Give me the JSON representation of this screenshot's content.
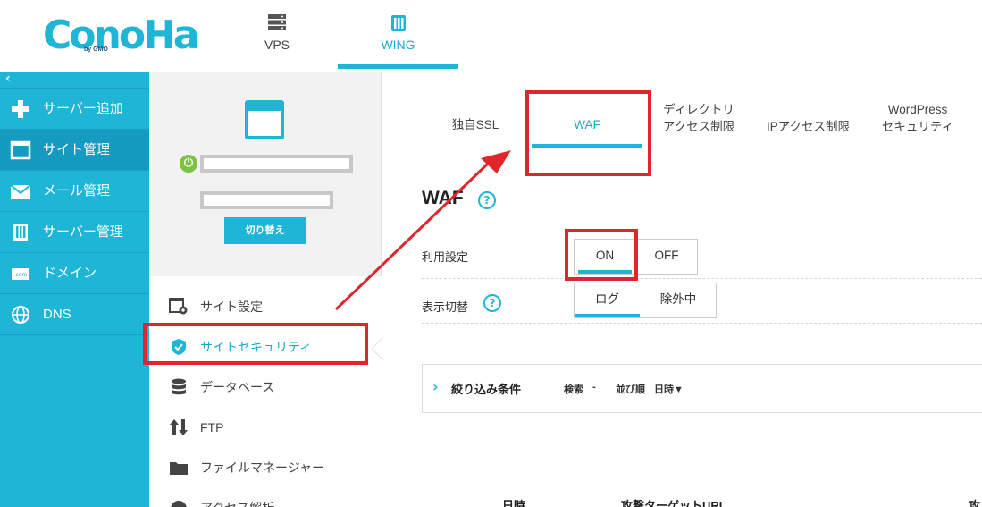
{
  "header": {
    "logo_text": "ConoHa",
    "logo_sub": "by GMO",
    "tabs": [
      {
        "label": "VPS",
        "icon": "server-stack-icon"
      },
      {
        "label": "WING",
        "icon": "wing-server-icon"
      }
    ]
  },
  "sidebar": {
    "collapse_label": "‹",
    "items": [
      {
        "label": "サーバー追加",
        "icon": "plus-icon"
      },
      {
        "label": "サイト管理",
        "icon": "window-icon"
      },
      {
        "label": "メール管理",
        "icon": "mail-icon"
      },
      {
        "label": "サーバー管理",
        "icon": "server-icon"
      },
      {
        "label": "ドメイン",
        "icon": "domain-icon"
      },
      {
        "label": "DNS",
        "icon": "globe-icon"
      }
    ]
  },
  "server_card": {
    "switch_label": "切り替え"
  },
  "site_menu": {
    "items": [
      {
        "label": "サイト設定",
        "icon": "site-settings-icon"
      },
      {
        "label": "サイトセキュリティ",
        "icon": "shield-check-icon"
      },
      {
        "label": "データベース",
        "icon": "database-icon"
      },
      {
        "label": "FTP",
        "icon": "transfer-arrows-icon"
      },
      {
        "label": "ファイルマネージャー",
        "icon": "folder-icon"
      },
      {
        "label": "アクセス解析",
        "icon": "pie-chart-icon"
      }
    ]
  },
  "security_tabs": {
    "ssl": "独自SSL",
    "waf": "WAF",
    "dir_line1": "ディレクトリ",
    "dir_line2": "アクセス制限",
    "ip": "IPアクセス制限",
    "wp_line1": "WordPress",
    "wp_line2": "セキュリティ"
  },
  "waf": {
    "title": "WAF",
    "help": "?",
    "usage_label": "利用設定",
    "on": "ON",
    "off": "OFF",
    "display_label": "表示切替",
    "log": "ログ",
    "excluded": "除外中"
  },
  "filter": {
    "chevron": "›",
    "title": "絞り込み条件",
    "search_label": "検索",
    "search_value": "-",
    "sort_label": "並び順",
    "sort_value": "日時▼"
  },
  "table": {
    "headers": [
      "日時",
      "攻撃ターゲットURL",
      "攻"
    ]
  },
  "colors": {
    "brand": "#1fb5d6",
    "sidebar_active": "#159bbf",
    "highlight": "#e0262b",
    "power_on": "#7cc243"
  }
}
